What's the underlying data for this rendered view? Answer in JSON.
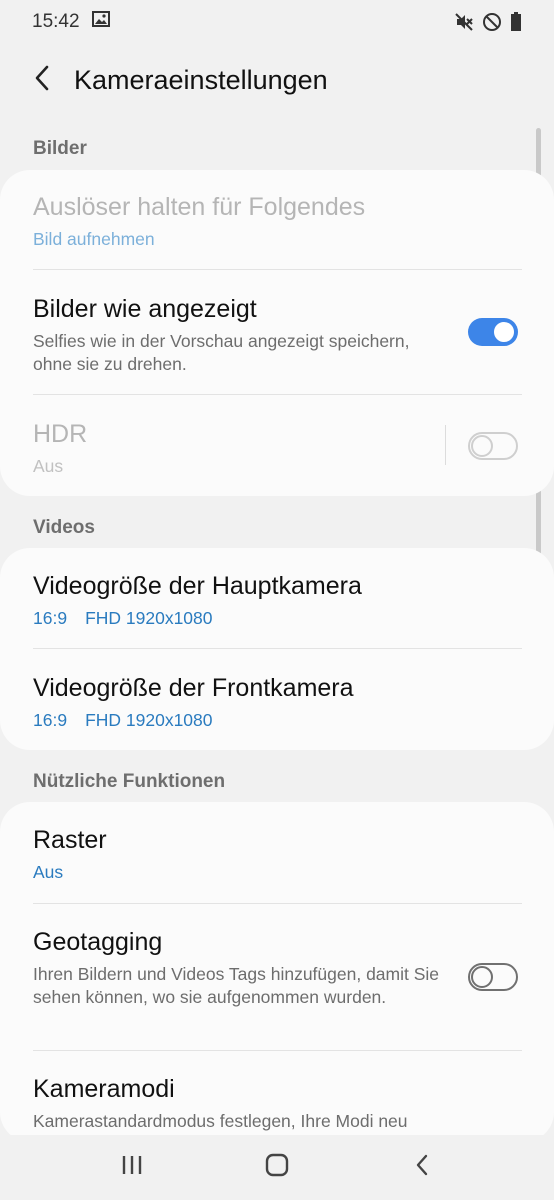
{
  "status": {
    "time": "15:42",
    "icons": [
      "gallery-icon",
      "mute-icon",
      "do-not-disturb-icon",
      "battery-icon"
    ]
  },
  "app_bar": {
    "back_icon": "chevron-left-icon",
    "title": "Kameraeinstellungen"
  },
  "sections": {
    "pictures": {
      "header": "Bilder",
      "shutter_hold": {
        "title": "Auslöser halten für Folgendes",
        "value": "Bild aufnehmen",
        "enabled": false
      },
      "save_as_previewed": {
        "title": "Bilder wie angezeigt",
        "description": "Selfies wie in der Vorschau angezeigt speichern, ohne sie zu drehen.",
        "toggle": "on"
      },
      "hdr": {
        "title": "HDR",
        "value": "Aus",
        "toggle": "off",
        "enabled": false
      }
    },
    "videos": {
      "header": "Videos",
      "rear_video_size": {
        "title": "Videogröße der Hauptkamera",
        "ratio": "16:9",
        "resolution": "FHD 1920x1080"
      },
      "front_video_size": {
        "title": "Videogröße der Frontkamera",
        "ratio": "16:9",
        "resolution": "FHD 1920x1080"
      }
    },
    "useful": {
      "header": "Nützliche Funktionen",
      "grid": {
        "title": "Raster",
        "value": "Aus"
      },
      "geotagging": {
        "title": "Geotagging",
        "description": "Ihren Bildern und Videos Tags hinzufügen, damit Sie sehen können, wo sie aufgenommen wurden.",
        "toggle": "off"
      },
      "camera_modes": {
        "title": "Kameramodi",
        "description": "Kamerastandardmodus festlegen, Ihre Modi neu"
      }
    }
  },
  "colors": {
    "accent": "#3d85e8",
    "link_blue": "#2a7bbf",
    "background": "#f1f1f1",
    "card": "#fbfbfb"
  },
  "nav_bar": {
    "icons": [
      "recent-apps-icon",
      "home-icon",
      "back-icon"
    ]
  }
}
